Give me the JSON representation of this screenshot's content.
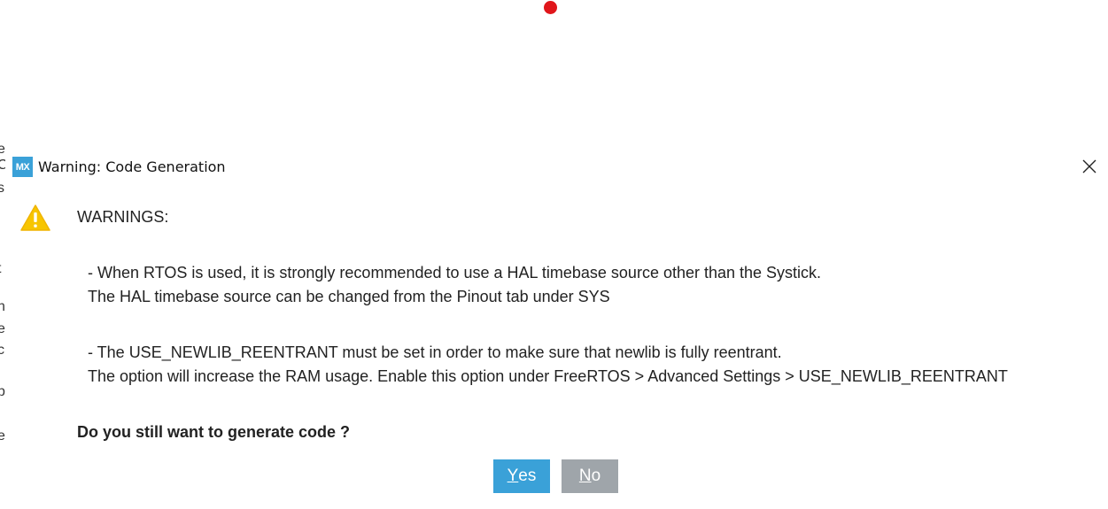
{
  "background": {
    "left_edge_glyphs": [
      "e",
      "C",
      "s",
      "t",
      "n",
      "e",
      "c",
      "p",
      "e"
    ]
  },
  "dialog": {
    "app_icon_text": "MX",
    "title": "Warning: Code Generation",
    "close_icon": "close-x-icon",
    "warning_icon": "warning-triangle-icon",
    "heading": "WARNINGS:",
    "messages": [
      "- When RTOS is used, it is strongly recommended to use a HAL timebase source other than the Systick.",
      "The HAL timebase source can be changed from the Pinout tab under SYS",
      "- The USE_NEWLIB_REENTRANT must be set in order to make sure that newlib is fully reentrant.",
      "The option will increase the RAM usage. Enable this option under FreeRTOS > Advanced Settings > USE_NEWLIB_REENTRANT"
    ],
    "question": "Do you still want to generate code ?",
    "buttons": {
      "yes": {
        "mnemonic": "Y",
        "rest": "es"
      },
      "no": {
        "mnemonic": "N",
        "rest": "o"
      }
    }
  },
  "colors": {
    "accent": "#3aa1d8",
    "no_button": "#9fa5aa",
    "warning_yellow": "#f7c500",
    "record_dot": "#e0161b"
  }
}
